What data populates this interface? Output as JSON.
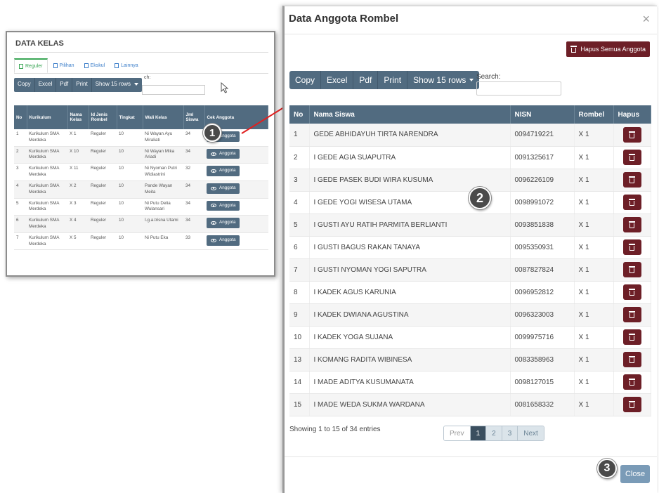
{
  "left_panel": {
    "title": "DATA KELAS",
    "tabs": [
      "Reguler",
      "Pilihan",
      "Ekskul",
      "Lainnya"
    ],
    "toolbar": [
      "Copy",
      "Excel",
      "Pdf",
      "Print",
      "Show 15 rows"
    ],
    "search_label": "ch:",
    "columns": [
      "No",
      "Kurikulum",
      "Nama Kelas",
      "Id Jenis Rombel",
      "Tingkat",
      "Wali Kelas",
      "Jml Siswa",
      "Cek Anggota"
    ],
    "rows": [
      {
        "no": "1",
        "kurikulum": "Kurikulum SMA Merdeka",
        "kelas": "X 1",
        "jenis": "Reguler",
        "tingkat": "10",
        "wali": "Ni Wayan Ayu Miraliati",
        "jml": "34",
        "btn": "Anggota"
      },
      {
        "no": "2",
        "kurikulum": "Kurikulum SMA Merdeka",
        "kelas": "X 10",
        "jenis": "Reguler",
        "tingkat": "10",
        "wali": "Ni Wayan Mika Ariadi",
        "jml": "34",
        "btn": "Anggota"
      },
      {
        "no": "3",
        "kurikulum": "Kurikulum SMA Merdeka",
        "kelas": "X 11",
        "jenis": "Reguler",
        "tingkat": "10",
        "wali": "Ni Nyoman Putri Widiastrini",
        "jml": "32",
        "btn": "Anggota"
      },
      {
        "no": "4",
        "kurikulum": "Kurikulum SMA Merdeka",
        "kelas": "X 2",
        "jenis": "Reguler",
        "tingkat": "10",
        "wali": "Pande Wayan Meita",
        "jml": "34",
        "btn": "Anggota"
      },
      {
        "no": "5",
        "kurikulum": "Kurikulum SMA Merdeka",
        "kelas": "X 3",
        "jenis": "Reguler",
        "tingkat": "10",
        "wali": "Ni Putu Delia Wulansari",
        "jml": "34",
        "btn": "Anggota"
      },
      {
        "no": "6",
        "kurikulum": "Kurikulum SMA Merdeka",
        "kelas": "X 4",
        "jenis": "Reguler",
        "tingkat": "10",
        "wali": "I.g.a.trisna Utami",
        "jml": "34",
        "btn": "Anggota"
      },
      {
        "no": "7",
        "kurikulum": "Kurikulum SMA Merdeka",
        "kelas": "X 5",
        "jenis": "Reguler",
        "tingkat": "10",
        "wali": "Ni Putu Eka",
        "jml": "33",
        "btn": "Anggota"
      }
    ]
  },
  "callouts": [
    "1",
    "2",
    "3"
  ],
  "modal": {
    "title": "Data Anggota Rombel",
    "close_x": "×",
    "hapus_semua": "Hapus Semua Anggota",
    "toolbar": {
      "copy": "Copy",
      "excel": "Excel",
      "pdf": "Pdf",
      "print": "Print",
      "show": "Show 15 rows"
    },
    "search_label": "Search:",
    "columns": [
      "No",
      "Nama Siswa",
      "NISN",
      "Rombel",
      "Hapus"
    ],
    "rows": [
      {
        "no": "1",
        "nama": "GEDE ABHIDAYUH TIRTA NARENDRA",
        "nisn": "0094719221",
        "rombel": "X 1"
      },
      {
        "no": "2",
        "nama": "I GEDE AGIA SUAPUTRA",
        "nisn": "0091325617",
        "rombel": "X 1"
      },
      {
        "no": "3",
        "nama": "I GEDE PASEK BUDI WIRA KUSUMA",
        "nisn": "0096226109",
        "rombel": "X 1"
      },
      {
        "no": "4",
        "nama": "I GEDE YOGI WISESA UTAMA",
        "nisn": "0098991072",
        "rombel": "X 1"
      },
      {
        "no": "5",
        "nama": "I GUSTI AYU RATIH PARMITA BERLIANTI",
        "nisn": "0093851838",
        "rombel": "X 1"
      },
      {
        "no": "6",
        "nama": "I GUSTI BAGUS RAKAN TANAYA",
        "nisn": "0095350931",
        "rombel": "X 1"
      },
      {
        "no": "7",
        "nama": "I GUSTI NYOMAN YOGI SAPUTRA",
        "nisn": "0087827824",
        "rombel": "X 1"
      },
      {
        "no": "8",
        "nama": "I KADEK AGUS KARUNIA",
        "nisn": "0096952812",
        "rombel": "X 1"
      },
      {
        "no": "9",
        "nama": "I KADEK DWIANA AGUSTINA",
        "nisn": "0096323003",
        "rombel": "X 1"
      },
      {
        "no": "10",
        "nama": "I KADEK YOGA SUJANA",
        "nisn": "0099975716",
        "rombel": "X 1"
      },
      {
        "no": "13",
        "nama": "I KOMANG RADITA WIBINESA",
        "nisn": "0083358963",
        "rombel": "X 1"
      },
      {
        "no": "14",
        "nama": "I MADE ADITYA KUSUMANATA",
        "nisn": "0098127015",
        "rombel": "X 1"
      },
      {
        "no": "15",
        "nama": "I MADE WEDA SUKMA WARDANA",
        "nisn": "0081658332",
        "rombel": "X 1"
      }
    ],
    "showing": "Showing 1 to 15 of 34 entries",
    "pagination": [
      "Prev",
      "1",
      "2",
      "3",
      "Next"
    ],
    "close": "Close"
  },
  "colors": {
    "header": "#516b80",
    "danger": "#6d1f27",
    "close": "#7a9bb7",
    "active_page": "#3b4f5f"
  },
  "icons": [
    "list-icon",
    "eye-icon",
    "trash-icon",
    "cursor-icon",
    "caret-down-icon",
    "close-icon"
  ]
}
